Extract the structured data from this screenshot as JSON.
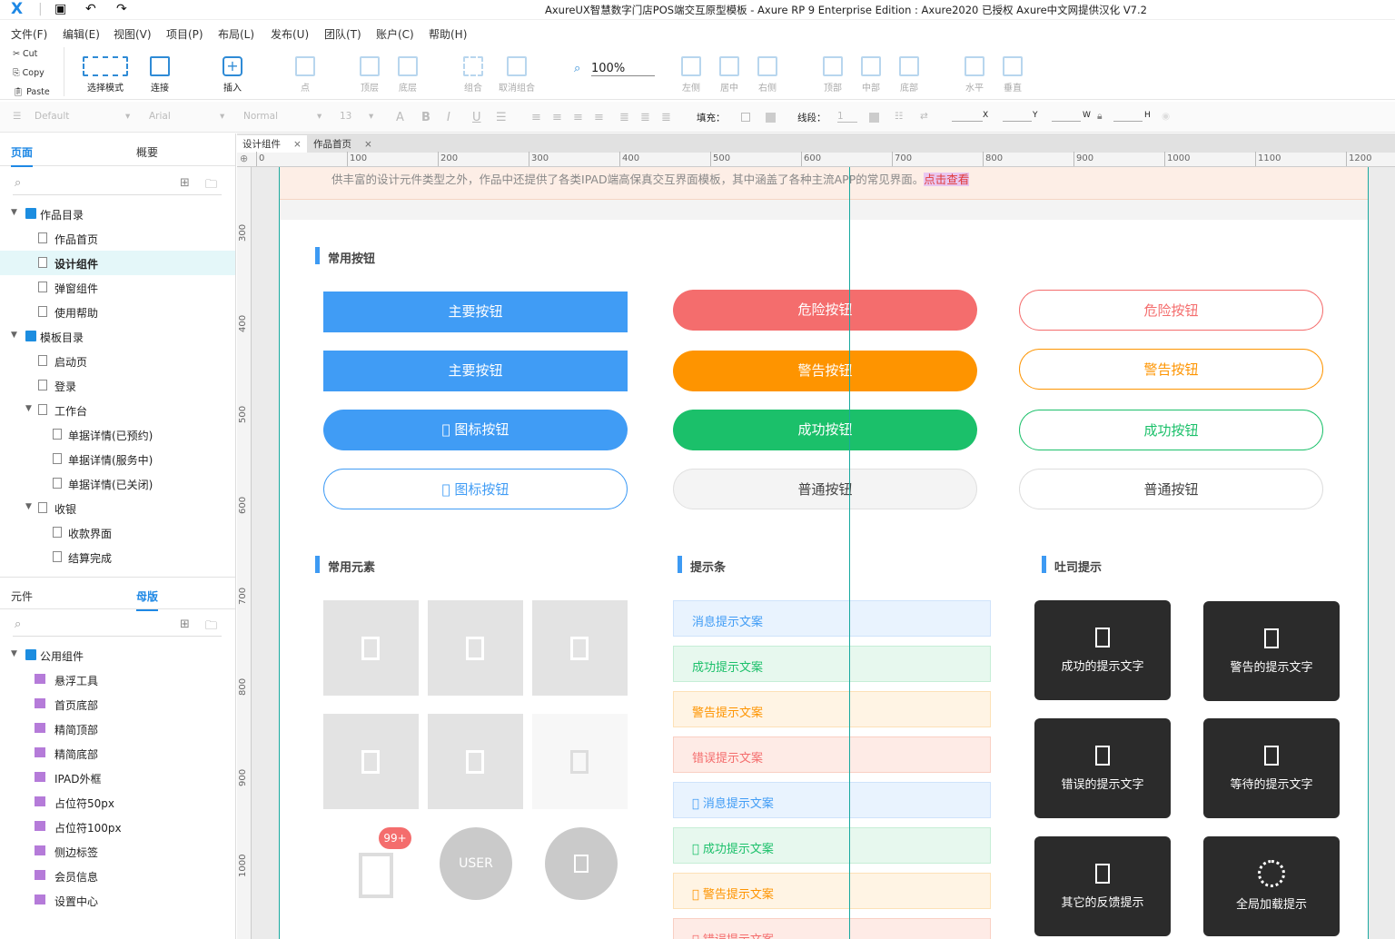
{
  "titlebar": {
    "title": "AxureUX智慧数字门店POS端交互原型模板 - Axure RP 9 Enterprise Edition : Axure2020 已授权     Axure中文网提供汉化 V7.2",
    "logo": "X"
  },
  "menu": [
    "文件(F)",
    "编辑(E)",
    "视图(V)",
    "项目(P)",
    "布局(L)",
    "发布(U)",
    "团队(T)",
    "账户(C)",
    "帮助(H)"
  ],
  "clipboard": [
    "Cut",
    "Copy",
    "Paste"
  ],
  "toolbar": {
    "select_mode": "选择模式",
    "connect": "连接",
    "insert": "插入",
    "point": "点",
    "top_layer": "顶层",
    "bottom_layer": "底层",
    "group": "组合",
    "ungroup": "取消组合",
    "zoom": "100%",
    "align_left": "左侧",
    "align_center": "居中",
    "align_right": "右侧",
    "align_top": "顶部",
    "align_middle": "中部",
    "align_bottom": "底部",
    "dist_h": "水平",
    "dist_v": "垂直"
  },
  "format": {
    "style": "Default",
    "font": "Arial",
    "weight": "Normal",
    "size": "13",
    "fill_label": "填充：",
    "line_label": "线段：",
    "line_value": "1",
    "x": "X",
    "y": "Y",
    "w": "W",
    "h": "H"
  },
  "pages_panel": {
    "tab_pages": "页面",
    "tab_outline": "概要",
    "items": [
      {
        "label": "作品目录",
        "type": "folder",
        "level": 0,
        "expanded": true
      },
      {
        "label": "作品首页",
        "type": "page",
        "level": 1
      },
      {
        "label": "设计组件",
        "type": "page",
        "level": 1,
        "selected": true
      },
      {
        "label": "弹窗组件",
        "type": "page",
        "level": 1
      },
      {
        "label": "使用帮助",
        "type": "page",
        "level": 1
      },
      {
        "label": "模板目录",
        "type": "folder",
        "level": 0,
        "expanded": true
      },
      {
        "label": "启动页",
        "type": "page",
        "level": 1
      },
      {
        "label": "登录",
        "type": "page",
        "level": 1
      },
      {
        "label": "工作台",
        "type": "page",
        "level": 1,
        "expanded": true
      },
      {
        "label": "单据详情(已预约)",
        "type": "page",
        "level": 2
      },
      {
        "label": "单据详情(服务中)",
        "type": "page",
        "level": 2
      },
      {
        "label": "单据详情(已关闭)",
        "type": "page",
        "level": 2
      },
      {
        "label": "收银",
        "type": "page",
        "level": 1,
        "expanded": true
      },
      {
        "label": "收款界面",
        "type": "page",
        "level": 2
      },
      {
        "label": "结算完成",
        "type": "page",
        "level": 2
      }
    ]
  },
  "masters_panel": {
    "tab_widgets": "元件",
    "tab_masters": "母版",
    "items": [
      {
        "label": "公用组件",
        "type": "folder",
        "level": 0,
        "expanded": true
      },
      {
        "label": "悬浮工具",
        "type": "master",
        "level": 1
      },
      {
        "label": "首页底部",
        "type": "master",
        "level": 1
      },
      {
        "label": "精简顶部",
        "type": "master",
        "level": 1
      },
      {
        "label": "精简底部",
        "type": "master",
        "level": 1
      },
      {
        "label": "IPAD外框",
        "type": "master",
        "level": 1
      },
      {
        "label": "占位符50px",
        "type": "master",
        "level": 1
      },
      {
        "label": "占位符100px",
        "type": "master",
        "level": 1
      },
      {
        "label": "侧边标签",
        "type": "master",
        "level": 1
      },
      {
        "label": "会员信息",
        "type": "master",
        "level": 1
      },
      {
        "label": "设置中心",
        "type": "master",
        "level": 1
      }
    ]
  },
  "doc_tabs": [
    {
      "label": "设计组件",
      "active": true
    },
    {
      "label": "作品首页",
      "active": false
    }
  ],
  "ruler_h": [
    "0",
    "100",
    "200",
    "300",
    "400",
    "500",
    "600",
    "700",
    "800",
    "900",
    "1000",
    "1100",
    "1200"
  ],
  "ruler_v": [
    "300",
    "400",
    "500",
    "600",
    "700",
    "800",
    "900",
    "1000"
  ],
  "canvas": {
    "notice": "供丰富的设计元件类型之外，作品中还提供了各类IPAD端高保真交互界面模板，其中涵盖了各种主流APP的常见界面。",
    "notice_link": "点击查看",
    "sec_buttons": "常用按钮",
    "sec_elements": "常用元素",
    "sec_alerts": "提示条",
    "sec_toasts": "吐司提示",
    "buttons": {
      "primary": "主要按钮",
      "primary2": "主要按钮",
      "icon_btn": "󰀀 图标按钮",
      "icon_btn_outline": "󰀀 图标按钮",
      "danger": "危险按钮",
      "warning": "警告按钮",
      "success": "成功按钮",
      "normal": "普通按钮",
      "danger_o": "危险按钮",
      "warning_o": "警告按钮",
      "success_o": "成功按钮",
      "normal_o": "普通按钮"
    },
    "badge": "99+",
    "avatar_text": "USER",
    "alerts": [
      "消息提示文案",
      "成功提示文案",
      "警告提示文案",
      "错误提示文案",
      "󰀀 消息提示文案",
      "󰀀 成功提示文案",
      "󰀀 警告提示文案",
      "󰀀 错误提示文案"
    ],
    "toasts": [
      "成功的提示文字",
      "警告的提示文字",
      "错误的提示文字",
      "等待的提示文字",
      "其它的反馈提示",
      "全局加载提示"
    ]
  }
}
